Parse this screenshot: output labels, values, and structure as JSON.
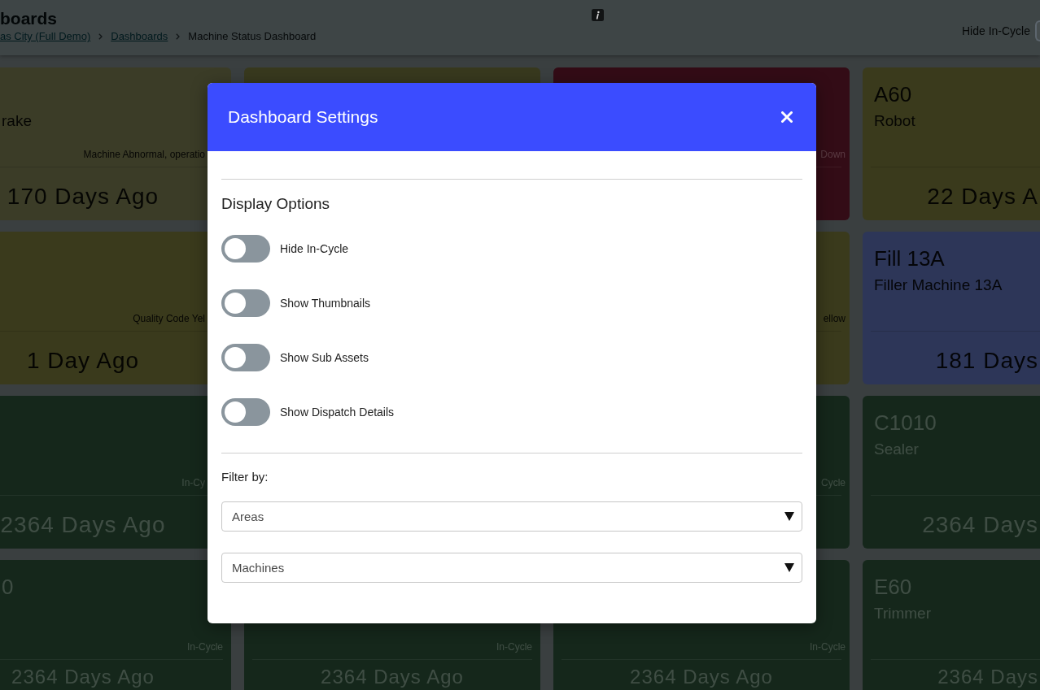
{
  "header": {
    "title": "boards",
    "breadcrumb": [
      {
        "label": "as City (Full Demo)",
        "link": true
      },
      {
        "label": "Dashboards",
        "link": true
      },
      {
        "label": "Machine Status Dashboard",
        "link": false
      }
    ],
    "hide_in_cycle": {
      "label": "Hide In-Cycle",
      "on": false
    }
  },
  "card_rows": [
    [
      {
        "color": "#3b3c27",
        "subtitle": "rake",
        "status": "Machine Abnormal, operatio",
        "time": "170 Days Ago"
      },
      {
        "color": "#38391e"
      },
      {
        "color": "#330c16",
        "status": "Down"
      },
      {
        "color": "#3a3a1c",
        "title": "A60",
        "subtitle": "Robot",
        "time": "22 Days A"
      }
    ],
    [
      {
        "color": "#3a3a1c",
        "status": "Quality Code Yel",
        "time": "1 Day Ago"
      },
      null,
      {
        "color": "#3a3a1c",
        "status": "ellow"
      },
      {
        "color": "#2d3658",
        "title": "Fill 13A",
        "subtitle": "Filler Machine 13A",
        "time": "181 Days"
      }
    ],
    [
      {
        "color": "#15271b",
        "status": "In-Cy",
        "time": "2364 Days Ago"
      },
      null,
      {
        "color": "#15271b",
        "status": "Cycle"
      },
      {
        "color": "#15271b",
        "title": "C1010",
        "subtitle": "Sealer",
        "time": "2364 Days"
      }
    ],
    [
      {
        "color": "#15271b",
        "title": "0",
        "status": "In-Cycle",
        "time": "2364 Days Ago"
      },
      {
        "color": "#15271b",
        "status": "In-Cycle",
        "time": "2364 Days Ago"
      },
      {
        "color": "#15271b",
        "status": "In-Cycle",
        "time": "2364 Days Ago"
      },
      {
        "color": "#15271b",
        "title": "E60",
        "subtitle": "Trimmer",
        "time": "2364 Days"
      }
    ]
  ],
  "modal": {
    "title": "Dashboard Settings",
    "section_title": "Display Options",
    "options": [
      {
        "label": "Hide In-Cycle",
        "on": false
      },
      {
        "label": "Show Thumbnails",
        "on": false
      },
      {
        "label": "Show Sub Assets",
        "on": false
      },
      {
        "label": "Show Dispatch Details",
        "on": false
      }
    ],
    "filter_label": "Filter by:",
    "filters": [
      {
        "value": "Areas"
      },
      {
        "value": "Machines"
      }
    ]
  }
}
